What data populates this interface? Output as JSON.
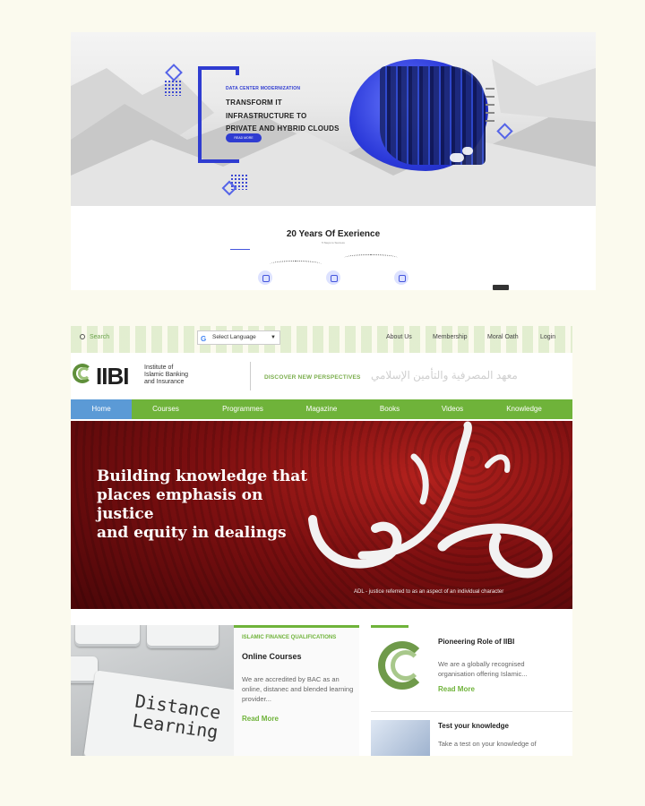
{
  "shot1": {
    "hero": {
      "eyebrow": "DATA CENTER MODERNIZATION",
      "title_lines": [
        "TRANSFORM IT",
        "INFRASTRUCTURE TO",
        "PRIVATE AND HYBRID CLOUDS"
      ],
      "button_label": "READ MORE"
    },
    "experience": {
      "tag": "",
      "title": "20 Years Of Exerience",
      "subtitle": "5 Steps to Success"
    }
  },
  "shot2": {
    "topbar": {
      "search_label": "Search",
      "translate_label": "Select Language",
      "links": [
        "About Us",
        "Membership",
        "Moral Oath",
        "Login"
      ]
    },
    "logo": {
      "mark": "IIBI",
      "lines": [
        "Institute of",
        "Islamic Banking",
        "and Insurance"
      ],
      "tagline": "DISCOVER NEW PERSPECTIVES",
      "arabic": "معهد المصرفية والتأمين الإسلامي"
    },
    "nav": [
      "Home",
      "Courses",
      "Programmes",
      "Magazine",
      "Books",
      "Videos",
      "Knowledge"
    ],
    "banner": {
      "headline_lines": [
        "Building knowledge that",
        "places emphasis on justice",
        "and equity in dealings"
      ],
      "calligraphy": "عدل",
      "caption": "ADL - justice referred to as an aspect of an individual character"
    },
    "card_image_text": [
      "Distance",
      "Learning"
    ],
    "online_courses": {
      "eyebrow": "ISLAMIC FINANCE QUALIFICATIONS",
      "title": "Online Courses",
      "body": "We are accredited by BAC as an online, distanec and blended learning provider...",
      "read_more": "Read More"
    },
    "pioneering": {
      "title": "Pioneering Role of IIBI",
      "body": "We are a globally recognised organisation offering Islamic...",
      "read_more": "Read More"
    },
    "test": {
      "title": "Test your knowledge",
      "body": "Take a test on your knowledge of"
    }
  },
  "colors": {
    "page_bg": "#fbfaee",
    "accent_blue": "#2f3cd1",
    "iibi_green": "#6fb33a",
    "nav_active": "#5b9ad6",
    "banner_red": "#7c0f10"
  }
}
